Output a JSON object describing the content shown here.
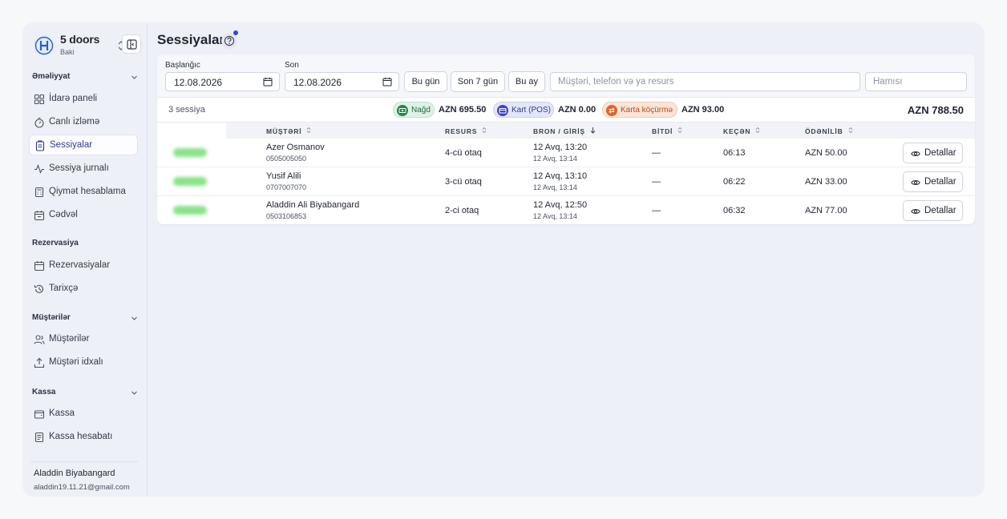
{
  "sidebar": {
    "brand_name": "5 doors",
    "brand_sub": "Baki",
    "groups": [
      {
        "title": "Əməliyyat",
        "items": [
          "İdarə paneli",
          "Canlı izləmə",
          "Sessiyalar",
          "Sessiya jurnalı",
          "Qiymət hesablama",
          "Cədvəl"
        ]
      },
      {
        "title": "Rezervasiya",
        "items": [
          "Rezervasiyalar",
          "Tarixçə"
        ]
      },
      {
        "title": "Müştərilər",
        "items": [
          "Müştərilər",
          "Müştəri idxalı"
        ]
      },
      {
        "title": "Kassa",
        "items": [
          "Kassa",
          "Kassa hesabatı"
        ]
      }
    ],
    "user_name": "Aladdin Biyabangard",
    "user_email": "aladdin19.11.21@gmail.com"
  },
  "page": {
    "title": "Sessiyalar"
  },
  "filters": {
    "start_label": "Başlanğıc",
    "start_value": "12.08.2026",
    "end_label": "Son",
    "end_value": "12.08.2026",
    "btn_today": "Bu gün",
    "btn_7days": "Son 7 gün",
    "btn_month": "Bu ay",
    "search_placeholder": "Müştəri, telefon və ya resurs",
    "status_placeholder": "Hamısı"
  },
  "summary": {
    "count": "3 sessiya",
    "cash_label": "Nağd",
    "cash_amount": "AZN 695.50",
    "card_label": "Kart (POS)",
    "card_amount": "AZN 0.00",
    "transfer_label": "Karta köçürmə",
    "transfer_amount": "AZN 93.00",
    "total": "AZN 788.50"
  },
  "table": {
    "headers": [
      "MÜŞTƏRİ",
      "RESURS",
      "BRON / GİRİŞ",
      "BİTDİ",
      "KEÇƏN",
      "ÖDƏNİLİB"
    ],
    "detail_label": "Detallar",
    "rows": [
      {
        "name": "Azer Osmanov",
        "phone": "0505005050",
        "resource": "4-cü otaq",
        "start": "12 Avq, 13:20",
        "start_sub": "12 Avq, 13:14",
        "end": "—",
        "elapsed": "06:13",
        "paid": "AZN 50.00"
      },
      {
        "name": "Yusif Alili",
        "phone": "0707007070",
        "resource": "3-cü otaq",
        "start": "12 Avq, 13:10",
        "start_sub": "12 Avq, 13:14",
        "end": "—",
        "elapsed": "06:22",
        "paid": "AZN 33.00"
      },
      {
        "name": "Aladdin Ali Biyabangard",
        "phone": "0503106853",
        "resource": "2-ci otaq",
        "start": "12 Avq, 12:50",
        "start_sub": "12 Avq, 13:14",
        "end": "—",
        "elapsed": "06:32",
        "paid": "AZN 77.00"
      }
    ]
  },
  "colors": {
    "accent": "#3b45c7",
    "cash": "#1f8a4c",
    "card": "#3b45c7",
    "transfer": "#e0612b"
  }
}
